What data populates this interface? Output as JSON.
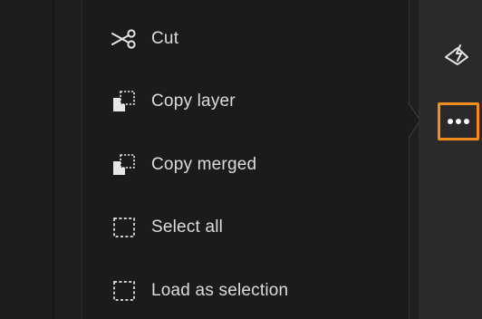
{
  "menu": {
    "items": [
      {
        "label": "Cut",
        "icon": "scissors-icon"
      },
      {
        "label": "Copy layer",
        "icon": "copy-layer-icon"
      },
      {
        "label": "Copy merged",
        "icon": "copy-merged-icon"
      },
      {
        "label": "Select all",
        "icon": "select-all-icon"
      },
      {
        "label": "Load as selection",
        "icon": "load-selection-icon"
      }
    ]
  },
  "toolbar": {
    "tools": [
      {
        "icon": "healing-brush-icon"
      },
      {
        "icon": "more-options-icon",
        "highlighted": true
      }
    ],
    "highlight_color": "#f28c1e"
  },
  "colors": {
    "text": "#dcdcdc",
    "accent": "#f28c1e"
  }
}
